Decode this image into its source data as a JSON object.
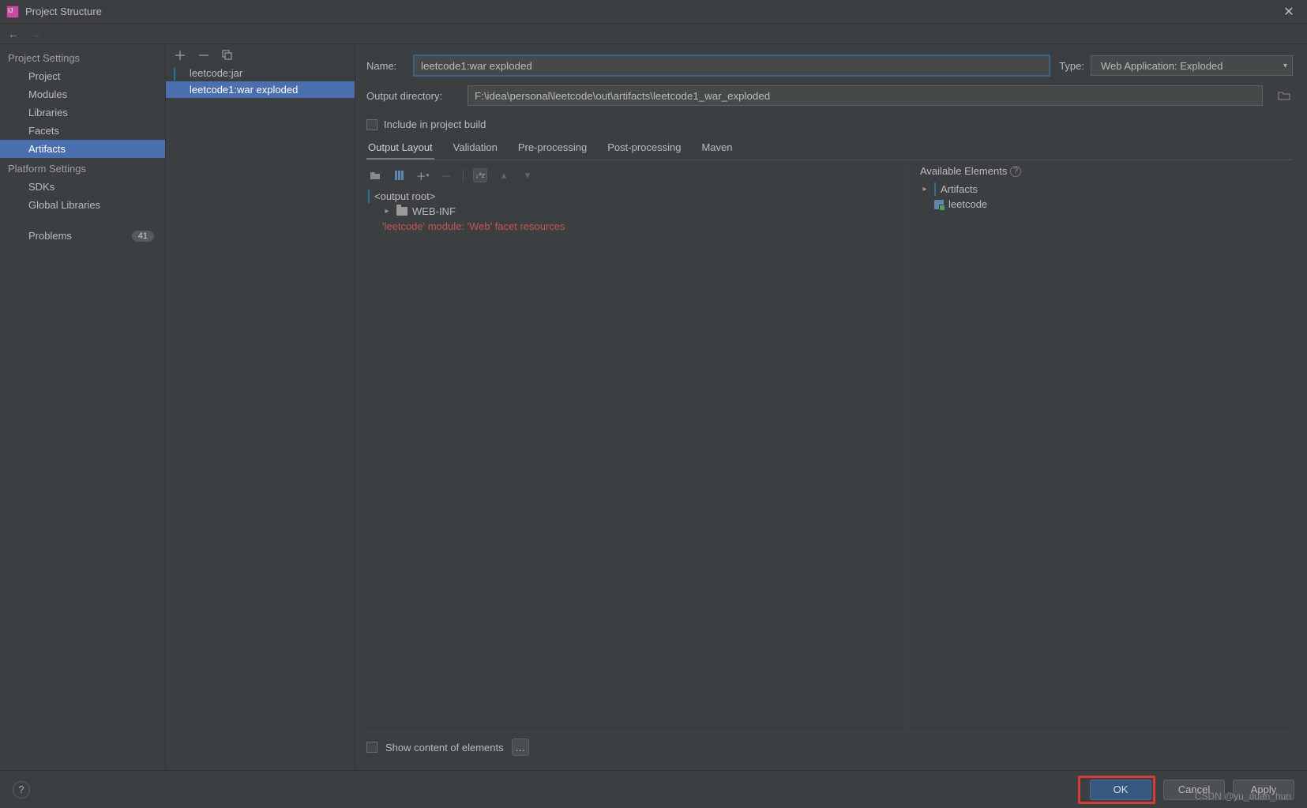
{
  "window": {
    "title": "Project Structure"
  },
  "nav": {
    "back_enabled": true,
    "fwd_enabled": false
  },
  "sidebar": {
    "project_settings_label": "Project Settings",
    "platform_settings_label": "Platform Settings",
    "items_proj": [
      "Project",
      "Modules",
      "Libraries",
      "Facets",
      "Artifacts"
    ],
    "items_plat": [
      "SDKs",
      "Global Libraries"
    ],
    "selected": "Artifacts",
    "problems_label": "Problems",
    "problems_count": "41"
  },
  "artifacts_list": {
    "items": [
      {
        "label": "leetcode:jar",
        "icon": "diamond"
      },
      {
        "label": "leetcode1:war exploded",
        "icon": "diamond-g"
      }
    ],
    "selected_index": 1
  },
  "form": {
    "name_label": "Name:",
    "name_value": "leetcode1:war exploded",
    "type_label": "Type:",
    "type_value": "Web Application: Exploded",
    "out_label": "Output directory:",
    "out_value": "F:\\idea\\personal\\leetcode\\out\\artifacts\\leetcode1_war_exploded",
    "include_build": "Include in project build"
  },
  "tabs": {
    "items": [
      "Output Layout",
      "Validation",
      "Pre-processing",
      "Post-processing",
      "Maven"
    ],
    "active": 0
  },
  "output_layout": {
    "tree": {
      "root": "<output root>",
      "webinf": "WEB-INF",
      "warning": "'leetcode' module: 'Web' facet resources"
    },
    "available": {
      "header": "Available Elements",
      "artifacts": "Artifacts",
      "module": "leetcode"
    }
  },
  "show_content": "Show content of elements",
  "footer": {
    "ok": "OK",
    "cancel": "Cancel",
    "apply": "Apply"
  },
  "watermark": "CSDN @yu_duan_hun"
}
